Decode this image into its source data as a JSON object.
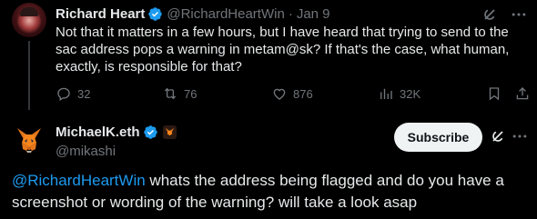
{
  "tweet": {
    "author_name": "Richard Heart",
    "author_handle": "@RichardHeartWin",
    "separator": "·",
    "date": "Jan 9",
    "text": "Not that it matters in a few hours, but I have heard that trying to send to the sac address pops a warning in metam@sk? If that's the case, what human, exactly, is responsible for that?",
    "stats": {
      "replies": "32",
      "retweets": "76",
      "likes": "876",
      "views": "32K"
    }
  },
  "reply": {
    "author_name": "MichaelK.eth",
    "author_handle": "@mikashi",
    "subscribe_label": "Subscribe",
    "mention": "@RichardHeartWin",
    "text": " whats the address being flagged and do you have a screenshot or wording of the warning? will take a look asap"
  },
  "colors": {
    "background": "#000000",
    "text": "#e7e9ea",
    "muted": "#71767b",
    "accent": "#1d9bf0",
    "verified": "#1d9bf0"
  },
  "icons": [
    "verified-badge-icon",
    "grok-icon",
    "more-icon",
    "reply-icon",
    "retweet-icon",
    "like-icon",
    "views-icon",
    "bookmark-icon",
    "share-icon",
    "metamask-fox-icon",
    "affiliate-badge-icon"
  ]
}
